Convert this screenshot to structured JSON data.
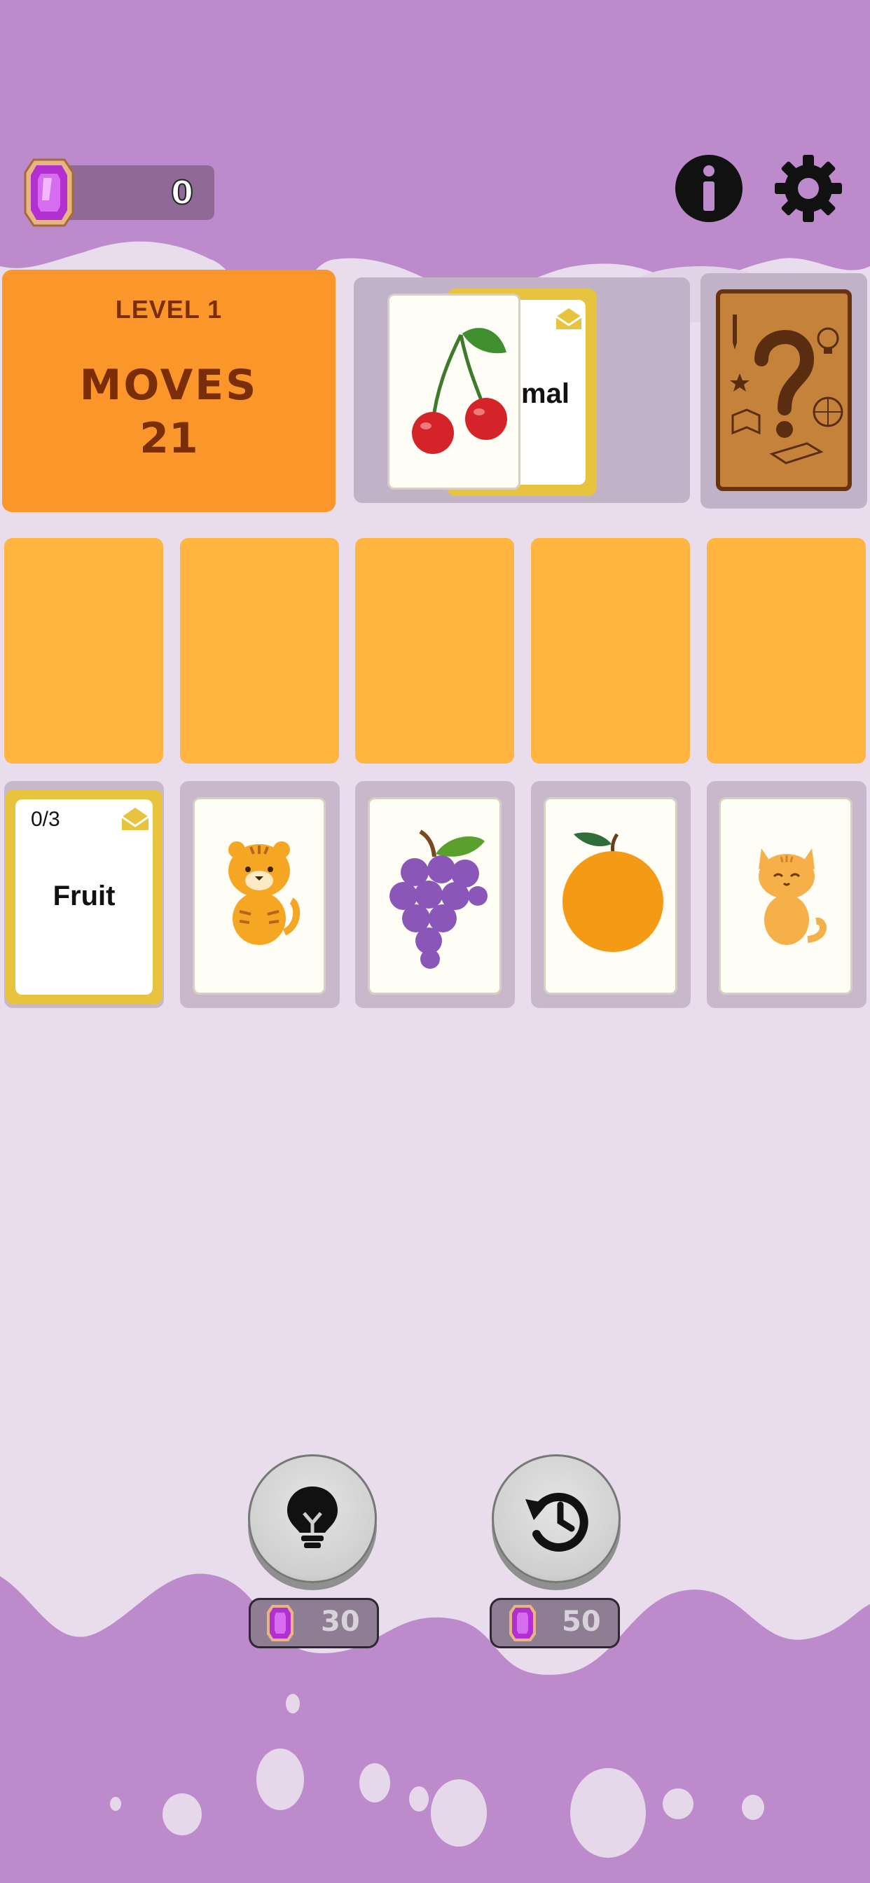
{
  "colors": {
    "background": "#e9dcec",
    "top_wave": "#bd8bcc",
    "level_panel": "#fb962b",
    "slot_orange": "#ffb53f",
    "category_frame": "#e8c33e",
    "slot_gray": "#c9b8cc",
    "level_text": "#7a2e08"
  },
  "header": {
    "gems": "0",
    "gem_icon": "purple-gem-icon",
    "info_icon": "info-icon",
    "settings_icon": "gear-icon"
  },
  "level_panel": {
    "level_text": "LEVEL 1",
    "moves_label": "MOVES",
    "moves_value": "21"
  },
  "stack": {
    "back_card_text": "mal",
    "front_card_icon": "cherry-icon"
  },
  "deck": {
    "icon": "mystery-question-card-icon"
  },
  "board": {
    "empty_slots": 5,
    "cards": [
      {
        "type": "category",
        "count": "0/3",
        "label": "Fruit"
      },
      {
        "type": "image",
        "icon": "tiger-icon"
      },
      {
        "type": "image",
        "icon": "grapes-icon"
      },
      {
        "type": "image",
        "icon": "orange-icon"
      },
      {
        "type": "image",
        "icon": "cat-icon"
      }
    ]
  },
  "boosters": [
    {
      "icon": "lightbulb-icon",
      "price": "30"
    },
    {
      "icon": "undo-history-icon",
      "price": "50"
    }
  ]
}
